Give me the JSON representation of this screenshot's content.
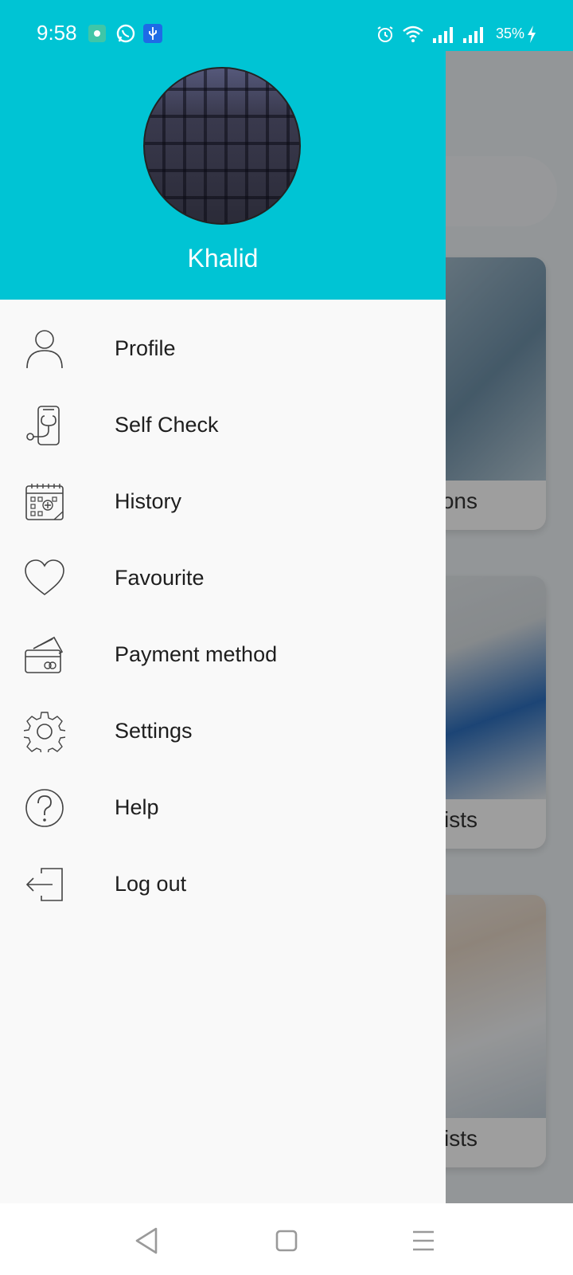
{
  "status_bar": {
    "time": "9:58",
    "battery": "35%",
    "icons": [
      "media-app-icon",
      "whatsapp-icon",
      "usb-icon",
      "alarm-icon",
      "wifi-icon",
      "signal-icon",
      "signal-icon",
      "charging-icon"
    ]
  },
  "drawer": {
    "user_name": "Khalid",
    "header_color": "#00c4d4",
    "items": [
      {
        "label": "Profile",
        "icon": "person-icon"
      },
      {
        "label": "Self Check",
        "icon": "phone-stethoscope-icon"
      },
      {
        "label": "History",
        "icon": "calendar-icon"
      },
      {
        "label": "Favourite",
        "icon": "heart-icon"
      },
      {
        "label": "Payment method",
        "icon": "credit-card-icon"
      },
      {
        "label": "Settings",
        "icon": "gear-icon"
      },
      {
        "label": "Help",
        "icon": "help-icon"
      },
      {
        "label": "Log out",
        "icon": "logout-icon"
      }
    ]
  },
  "background": {
    "cards": [
      {
        "caption": "ons"
      },
      {
        "caption": "gists"
      },
      {
        "caption": "ogists"
      }
    ]
  },
  "nav_bar": {
    "buttons": [
      "back-icon",
      "home-icon",
      "menu-icon"
    ]
  }
}
